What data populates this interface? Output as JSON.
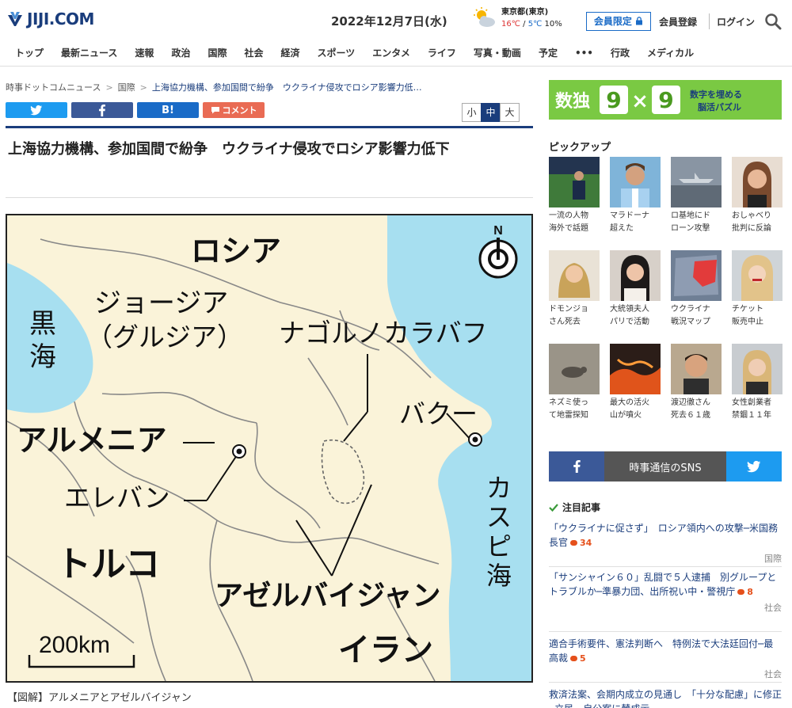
{
  "header": {
    "logo_text": "JIJI.COM",
    "date": "2022年12月7日(水)",
    "weather": {
      "city": "東京都(東京)",
      "high": "16℃",
      "sep": " / ",
      "low": "5℃",
      "precip": "10%"
    },
    "member_only_label": "会員限定",
    "register_label": "会員登録",
    "login_label": "ログイン"
  },
  "nav": {
    "items": [
      "トップ",
      "最新ニュース",
      "速報",
      "政治",
      "国際",
      "社会",
      "経済",
      "スポーツ",
      "エンタメ",
      "ライフ",
      "写真・動画",
      "予定",
      "•••",
      "行政",
      "メディカル"
    ]
  },
  "breadcrumb": {
    "items": [
      "時事ドットコムニュース",
      "国際",
      "上海協力機構、参加国間で紛争　ウクライナ侵攻でロシア影響力低…"
    ],
    "separator": ">"
  },
  "share": {
    "hatena_label": "B!",
    "comment_label": "コメント"
  },
  "font_size": {
    "small": "小",
    "medium": "中",
    "large": "大",
    "selected": "中"
  },
  "article": {
    "title": "上海協力機構、参加国間で紛争　ウクライナ侵攻でロシア影響力低下",
    "caption": "【図解】アルメニアとアゼルバイジャン"
  },
  "map": {
    "north_label": "N",
    "labels": {
      "russia": "ロシア",
      "georgia": "ジョージア",
      "georgia_alt": "（グルジア）",
      "black_sea_1": "黒",
      "black_sea_2": "海",
      "nagorno": "ナゴルノカラバフ",
      "baku": "バクー",
      "armenia": "アルメニア",
      "yerevan": "エレバン",
      "caspian_1": "カ",
      "caspian_2": "ス",
      "caspian_3": "ピ",
      "caspian_4": "海",
      "turkey": "トルコ",
      "azerbaijan": "アゼルバイジャン",
      "iran": "イラン",
      "scale": "200km"
    }
  },
  "ad": {
    "main": "数独",
    "digit_1": "9",
    "times": "×",
    "digit_2": "9",
    "sub_1": "数字を埋める",
    "sub_2": "脳活パズル"
  },
  "pickup": {
    "title": "ピックアップ",
    "items": [
      {
        "line1": "一流の人物",
        "line2": "海外で話題",
        "icon": "soccer-player-thumb"
      },
      {
        "line1": "マラドーナ",
        "line2": "超えた",
        "icon": "messi-thumb"
      },
      {
        "line1": "ロ基地にド",
        "line2": "ローン攻撃",
        "icon": "aircraft-thumb"
      },
      {
        "line1": "おしゃべり",
        "line2": "批判に反論",
        "icon": "woman-portrait-thumb"
      },
      {
        "line1": "ドモンジョ",
        "line2": "さん死去",
        "icon": "actress-thumb"
      },
      {
        "line1": "大統領夫人",
        "line2": "パリで活動",
        "icon": "first-lady-thumb"
      },
      {
        "line1": "ウクライナ",
        "line2": "戦況マップ",
        "icon": "war-map-thumb"
      },
      {
        "line1": "チケット",
        "line2": "販売中止",
        "icon": "singer-thumb"
      },
      {
        "line1": "ネズミ使っ",
        "line2": "て地雷探知",
        "icon": "rat-thumb"
      },
      {
        "line1": "最大の活火",
        "line2": "山が噴火",
        "icon": "lava-thumb"
      },
      {
        "line1": "渡辺徹さん",
        "line2": "死去６１歳",
        "icon": "actor-thumb"
      },
      {
        "line1": "女性創業者",
        "line2": "禁錮１１年",
        "icon": "founder-thumb"
      }
    ]
  },
  "sns": {
    "label": "時事通信のSNS"
  },
  "attention": {
    "title": "注目記事",
    "items": [
      {
        "title": "「ウクライナに促さず」　ロシア領内への攻撃─米国務長官",
        "comments": "34",
        "category": "国際"
      },
      {
        "title": "「サンシャイン６０」乱闘で５人逮捕　別グループとトラブルか─準暴力団、出所祝い中・警視庁",
        "comments": "8",
        "category": "社会"
      },
      {
        "title": "適合手術要件、憲法判断へ　特例法で大法廷回付─最高裁",
        "comments": "5",
        "category": "社会"
      },
      {
        "title": "救済法案、会期内成立の見通し　「十分な配慮」に修正─立民、自公案に賛成示",
        "comments": "",
        "category": ""
      }
    ]
  },
  "colors": {
    "brand_navy": "#1a3d7c",
    "twitter": "#1d9bf0",
    "facebook": "#3b5998",
    "comment": "#e96b54",
    "ad_green": "#7ac943",
    "sea": "#a7dff0",
    "land": "#faf3d9"
  }
}
